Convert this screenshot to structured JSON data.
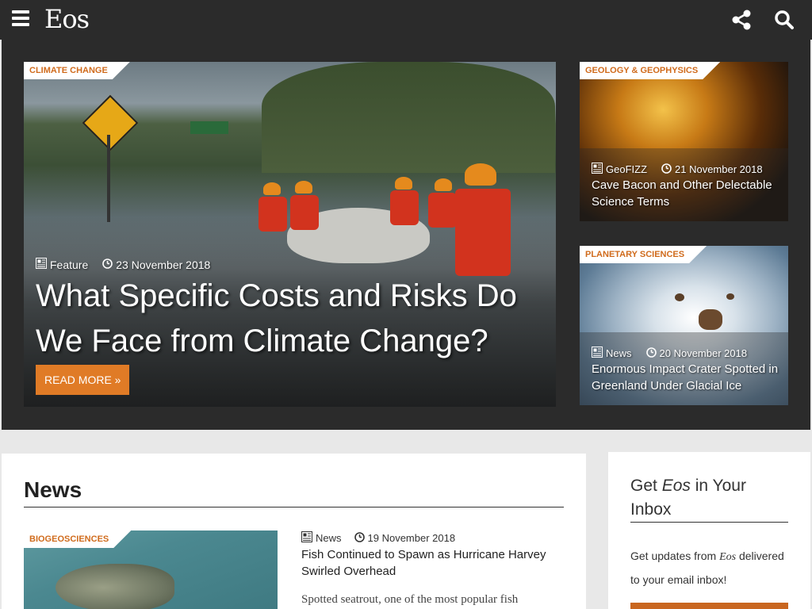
{
  "header": {
    "logo_text": "Eos",
    "menu_icon": "hamburger-menu-icon",
    "share_icon": "share-icon",
    "search_icon": "search-icon"
  },
  "hero": {
    "main": {
      "category": "CLIMATE CHANGE",
      "type": "Feature",
      "date": "23 November 2018",
      "title": "What Specific Costs and Risks Do We Face from Climate Change?",
      "button_label": "READ MORE »"
    },
    "side": [
      {
        "category": "GEOLOGY & GEOPHYSICS",
        "type": "GeoFIZZ",
        "date": "21 November 2018",
        "title": "Cave Bacon and Other Delectable Science Terms"
      },
      {
        "category": "PLANETARY SCIENCES",
        "type": "News",
        "date": "20 November 2018",
        "title": "Enormous Impact Crater Spotted in Greenland Under Glacial Ice"
      }
    ]
  },
  "news": {
    "heading": "News",
    "items": [
      {
        "category": "BIOGEOSCIENCES",
        "type": "News",
        "date": "19 November 2018",
        "title": "Fish Continued to Spawn as Hurricane Harvey Swirled Overhead",
        "excerpt": "Spotted seatrout, one of the most popular fish"
      }
    ]
  },
  "inbox": {
    "title_pre": "Get ",
    "title_em": "Eos",
    "title_post": " in Your Inbox",
    "text_pre": "Get updates from ",
    "text_em": "Eos",
    "text_post": " delivered to your email inbox!"
  },
  "colors": {
    "accent": "#e07b26",
    "category_text": "#d06b1c",
    "topbar_bg": "#2b2b2b"
  }
}
